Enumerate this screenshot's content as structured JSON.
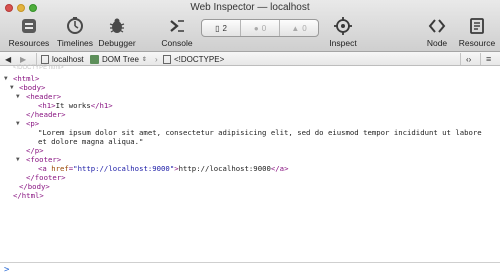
{
  "window": {
    "title": "Web Inspector — localhost"
  },
  "toolbar": {
    "resources": "Resources",
    "timelines": "Timelines",
    "debugger": "Debugger",
    "console": "Console",
    "inspect": "Inspect",
    "node": "Node",
    "resource": "Resource"
  },
  "status": {
    "logs": "2",
    "errors": "0",
    "warnings": "0"
  },
  "navbar": {
    "host": "localhost",
    "tree": "DOM Tree",
    "doctype": "<!DOCTYPE>"
  },
  "dom": {
    "ghost": "<!DOCTYPE html>",
    "html_open": "<html>",
    "body_open": "<body>",
    "header_open": "<header>",
    "h1_open": "<h1>",
    "h1_text": "It works",
    "h1_close": "</h1>",
    "header_close": "</header>",
    "p_open": "<p>",
    "p_line1": "\"Lorem ipsum dolor sit amet, consectetur adipisicing elit, sed do eiusmod tempor incididunt ut labore",
    "p_line2": "et dolore magna aliqua.\"",
    "p_close": "</p>",
    "footer_open": "<footer>",
    "a_open": "<a ",
    "a_attr": "href",
    "a_eq": "=",
    "a_val": "\"http://localhost:9000\"",
    "a_gt": ">",
    "a_text": "http://localhost:9000",
    "a_close": "</a>",
    "footer_close": "</footer>",
    "body_close": "</body>",
    "html_close": "</html>"
  },
  "console": {
    "prompt": ">"
  },
  "colors": {
    "tag": "#881280",
    "attr": "#994500",
    "value": "#1a1aa6",
    "accent": "#2a6bd6"
  }
}
